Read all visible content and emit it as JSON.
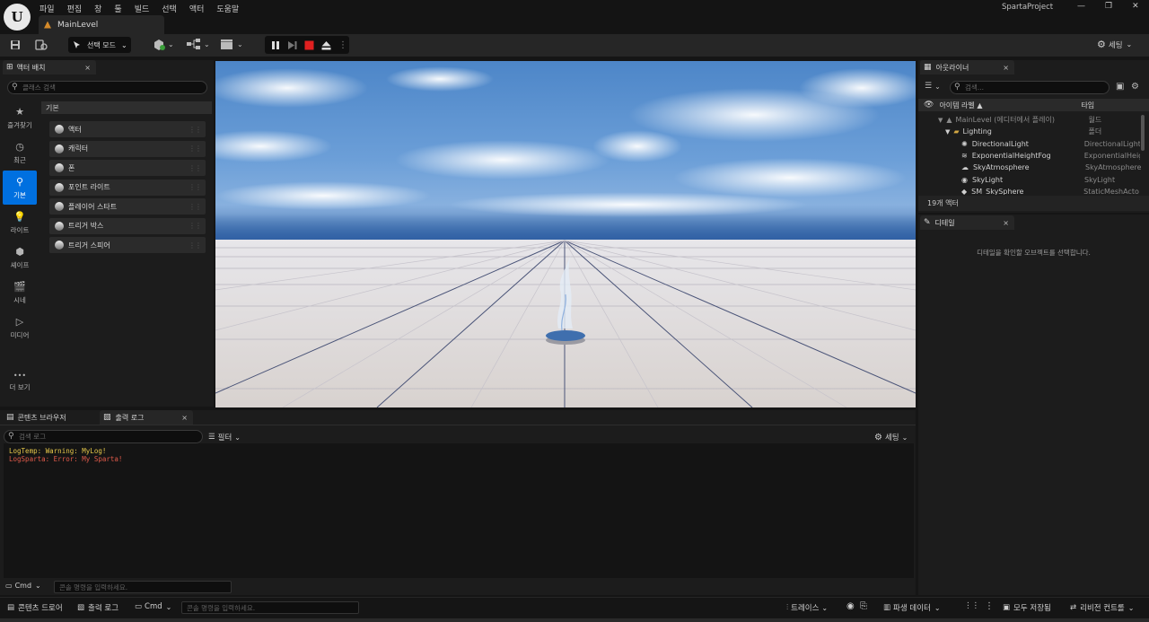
{
  "app": {
    "logo_letter": "U",
    "menu": [
      "파일",
      "편집",
      "창",
      "툴",
      "빌드",
      "선택",
      "액터",
      "도움말"
    ],
    "level_tab": "MainLevel",
    "project_name": "SpartaProject",
    "window_controls": [
      "—",
      "❐",
      "✕"
    ]
  },
  "toolbar": {
    "mode_label": "선택 모드",
    "settings_label": "세팅"
  },
  "place_actors": {
    "tab_label": "액터 배치",
    "close": "×",
    "search_placeholder": "클래스 검색",
    "categories": [
      {
        "icon": "★",
        "label": "즐겨찾기"
      },
      {
        "icon": "◷",
        "label": "최근"
      },
      {
        "icon": "⚲",
        "label": "기본"
      },
      {
        "icon": "💡",
        "label": "라이트"
      },
      {
        "icon": "⬢",
        "label": "셰이프"
      },
      {
        "icon": "🎬",
        "label": "시네"
      },
      {
        "icon": "▷",
        "label": "미디어"
      },
      {
        "icon": "•••",
        "label": "더 보기"
      }
    ],
    "section_header": "기본",
    "items": [
      "액터",
      "캐릭터",
      "폰",
      "포인트 라이트",
      "플레이어 스타트",
      "트리거 박스",
      "트리거 스피어"
    ]
  },
  "outliner": {
    "tab_label": "아웃라이너",
    "close": "×",
    "search_placeholder": "검색...",
    "col_label": "아이템 라벨 ▲",
    "col_type": "타입",
    "rows": [
      {
        "name": "MainLevel (에디터에서 플레이)",
        "type": "월드"
      },
      {
        "name": "Lighting",
        "type": "폴더"
      },
      {
        "name": "DirectionalLight",
        "type": "DirectionalLight"
      },
      {
        "name": "ExponentialHeightFog",
        "type": "ExponentialHeig"
      },
      {
        "name": "SkyAtmosphere",
        "type": "SkyAtmosphere"
      },
      {
        "name": "SkyLight",
        "type": "SkyLight"
      },
      {
        "name": "SM_SkySphere",
        "type": "StaticMeshActo"
      }
    ],
    "actor_count": "19개 액터"
  },
  "details": {
    "tab_label": "디테일",
    "close": "×",
    "empty_message": "디테일을 확인할 오브젝트를 선택합니다."
  },
  "bottom": {
    "tab_content_browser": "콘텐츠 브라우저",
    "tab_output_log": "출력 로그",
    "close": "×",
    "search_placeholder": "검색 로그",
    "filter_label": "필터",
    "settings_label": "세팅",
    "log_lines": [
      {
        "text": "LogTemp: Warning: MyLog!",
        "color": "#e6c84a"
      },
      {
        "text": "LogSparta: Error: My Sparta!",
        "color": "#e05a4a"
      }
    ],
    "cmd_label": "Cmd",
    "cmd_placeholder": "콘솔 명령을 입력하세요."
  },
  "statusbar": {
    "content_drawer": "콘텐츠 드로어",
    "output_log": "출력 로그",
    "cmd_label": "Cmd",
    "cmd_placeholder": "콘솔 명령을 입력하세요.",
    "trace": "트레이스",
    "derived_data": "파생 데이터",
    "save_all": "모두 저장됨",
    "revision_control": "리비전 컨트롤"
  },
  "colors": {
    "accent": "#0070e0",
    "warning": "#e6c84a",
    "error": "#e05a4a",
    "stop_button": "#e02020"
  }
}
